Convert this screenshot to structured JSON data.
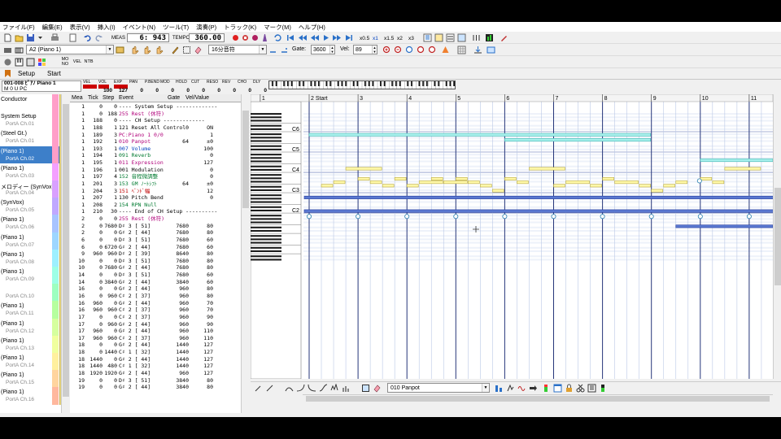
{
  "menu": [
    "ファイル(F)",
    "編集(E)",
    "表示(V)",
    "挿入(I)",
    "イベント(N)",
    "ツール(T)",
    "演奏(P)",
    "トラック(K)",
    "マーク(M)",
    "ヘルプ(H)"
  ],
  "transport": {
    "meas_label": "MEAS",
    "position": "6: 943",
    "tempo_label": "TEMPO",
    "tempo": "360.00",
    "speed_buttons": [
      "x0.5",
      "x1",
      "x1.5",
      "x2",
      "x3"
    ]
  },
  "toolbar2": {
    "track_select": "A2 (Piano 1)",
    "quantize": "16分音符",
    "gate_label": "Gate:",
    "gate": "3600",
    "vel_label": "Vel:",
    "vel": "89"
  },
  "toolbar3": {
    "toggles": [
      "MO\nNO",
      "VEL",
      "NTB"
    ]
  },
  "tabs": {
    "setup": "Setup",
    "start": "Start"
  },
  "strip": {
    "track_line1": "001-008 ﾋﾟｱﾉ Piano 1",
    "track_line2": "M   0   U   PC",
    "params": [
      {
        "name": "VEL",
        "value": "",
        "level": 1.0
      },
      {
        "name": "VOL",
        "value": "100",
        "level": 0.79
      },
      {
        "name": "EXP",
        "value": "127",
        "level": 1.0
      },
      {
        "name": "PAN",
        "value": "0",
        "level": 0.0
      },
      {
        "name": "P.BEND",
        "value": "0",
        "level": 0.0
      },
      {
        "name": "MOD",
        "value": "0",
        "level": 0.0
      },
      {
        "name": "HOLD",
        "value": "0",
        "level": 0.0
      },
      {
        "name": "CUT",
        "value": "0",
        "level": 0.0
      },
      {
        "name": "RESO",
        "value": "0",
        "level": 0.0
      },
      {
        "name": "REV",
        "value": "0",
        "level": 0.0
      },
      {
        "name": "CHO",
        "value": "0",
        "level": 0.0
      },
      {
        "name": "DLY",
        "value": "0",
        "level": 0.0
      }
    ]
  },
  "tracks": [
    {
      "name": "Conductor",
      "port": "",
      "color": "#ff9ec8"
    },
    {
      "name": "System Setup",
      "port": "PortA  Ch.01",
      "color": "#ff9ec8"
    },
    {
      "name": "(Steel Gt.)",
      "port": "PortA  Ch.01",
      "color": "#ff9ec8"
    },
    {
      "name": "(Piano 1)",
      "port": "PortA  Ch.02",
      "color": "#ff9ec8",
      "selected": true
    },
    {
      "name": "(Piano 1)",
      "port": "PortA  Ch.03",
      "color": "#f4a0ff"
    },
    {
      "name": "メロディー (SynVox)",
      "port": "PortA  Ch.04",
      "color": "#d9a0ff"
    },
    {
      "name": "(SynVox)",
      "port": "PortA  Ch.05",
      "color": "#c0a8ff"
    },
    {
      "name": "(Piano 1)",
      "port": "PortA  Ch.06",
      "color": "#a8c4ff"
    },
    {
      "name": "(Piano 1)",
      "port": "PortA  Ch.07",
      "color": "#9ed6ff"
    },
    {
      "name": "(Piano 1)",
      "port": "PortA  Ch.08",
      "color": "#9ef0ff"
    },
    {
      "name": "(Piano 1)",
      "port": "PortA  Ch.09",
      "color": "#9effe6"
    },
    {
      "name": "",
      "port": "PortA  Ch.10",
      "color": "#9effc0"
    },
    {
      "name": "(Piano 1)",
      "port": "PortA  Ch.11",
      "color": "#b6ff9e"
    },
    {
      "name": "(Piano 1)",
      "port": "PortA  Ch.12",
      "color": "#d6ff9e"
    },
    {
      "name": "(Piano 1)",
      "port": "PortA  Ch.13",
      "color": "#f0ff9e"
    },
    {
      "name": "(Piano 1)",
      "port": "PortA  Ch.14",
      "color": "#fff09e"
    },
    {
      "name": "(Piano 1)",
      "port": "PortA  Ch.15",
      "color": "#ffd49e"
    },
    {
      "name": "(Piano 1)",
      "port": "PortA  Ch.16",
      "color": "#ffb89e"
    }
  ],
  "event_headers": [
    "Mea",
    "Tick",
    "Step",
    "Event",
    "Gate",
    "Vel/Value"
  ],
  "events": [
    [
      "1",
      "0",
      "0",
      "---- System Setup -------------",
      "",
      "",
      "#000"
    ],
    [
      "1",
      "0",
      "188",
      "255 Rest (休符)",
      "",
      "",
      "#b0007a"
    ],
    [
      "1",
      "188",
      "0",
      "---- CH Setup -------------",
      "",
      "",
      "#000"
    ],
    [
      "1",
      "188",
      "1",
      "121 Reset All Control",
      "0",
      "ON",
      "#000"
    ],
    [
      "1",
      "189",
      "3",
      "PC:Piano 1        0/0",
      "",
      "1",
      "#b0007a"
    ],
    [
      "1",
      "192",
      "1",
      "010 Panpot",
      "64",
      "±0",
      "#b0007a"
    ],
    [
      "1",
      "193",
      "1",
      "007 Volume",
      "",
      "100",
      "#0040c0"
    ],
    [
      "1",
      "194",
      "1",
      "091 Reverb",
      "",
      "0",
      "#007a30"
    ],
    [
      "1",
      "195",
      "1",
      "011 Expression",
      "",
      "127",
      "#b0007a"
    ],
    [
      "1",
      "196",
      "1",
      "001 Modulation",
      "",
      "0",
      "#000"
    ],
    [
      "1",
      "197",
      "4",
      "152 音程微調整",
      "",
      "0",
      "#007a30"
    ],
    [
      "1",
      "201",
      "3",
      "153 GM ﾉｰﾄｼﾌﾄ",
      "64",
      "±0",
      "#007a30"
    ],
    [
      "1",
      "204",
      "3",
      "151 ﾍﾞﾝﾄﾞ幅",
      "",
      "12",
      "#c00000"
    ],
    [
      "1",
      "207",
      "1",
      "130 Pitch Bend",
      "",
      "0",
      "#000"
    ],
    [
      "1",
      "208",
      "2",
      "154 RPN Null",
      "",
      "",
      "#007a30"
    ],
    [
      "1",
      "210",
      "30",
      "---- End of CH Setup ----------",
      "",
      "",
      "#000"
    ],
    [
      "2",
      "0",
      "0",
      "255 Rest (休符)",
      "",
      "",
      "#b0007a"
    ],
    [
      "2",
      "0",
      "7680",
      "D♯ 3 [ 51]",
      "7680",
      "80",
      "#000"
    ],
    [
      "2",
      "0",
      "0",
      "G♯ 2 [ 44]",
      "7680",
      "80",
      "#000"
    ],
    [
      "6",
      "0",
      "0",
      "D♯ 3 [ 51]",
      "7680",
      "60",
      "#000"
    ],
    [
      "6",
      "0",
      "6720",
      "G♯ 2 [ 44]",
      "7680",
      "60",
      "#000"
    ],
    [
      "9",
      "960",
      "960",
      "D♯ 2 [ 39]",
      "8640",
      "80",
      "#000"
    ],
    [
      "10",
      "0",
      "0",
      "D♯ 3 [ 51]",
      "7680",
      "80",
      "#000"
    ],
    [
      "10",
      "0",
      "7680",
      "G♯ 2 [ 44]",
      "7680",
      "80",
      "#000"
    ],
    [
      "14",
      "0",
      "0",
      "D♯ 3 [ 51]",
      "7680",
      "60",
      "#000"
    ],
    [
      "14",
      "0",
      "3840",
      "G♯ 2 [ 44]",
      "3840",
      "60",
      "#000"
    ],
    [
      "16",
      "0",
      "0",
      "G♯ 2 [ 44]",
      "960",
      "80",
      "#000"
    ],
    [
      "16",
      "0",
      "960",
      "C♯ 2 [ 37]",
      "960",
      "80",
      "#000"
    ],
    [
      "16",
      "960",
      "0",
      "G♯ 2 [ 44]",
      "960",
      "70",
      "#000"
    ],
    [
      "16",
      "960",
      "960",
      "C♯ 2 [ 37]",
      "960",
      "70",
      "#000"
    ],
    [
      "17",
      "0",
      "0",
      "C♯ 2 [ 37]",
      "960",
      "90",
      "#000"
    ],
    [
      "17",
      "0",
      "960",
      "G♯ 2 [ 44]",
      "960",
      "90",
      "#000"
    ],
    [
      "17",
      "960",
      "0",
      "G♯ 2 [ 44]",
      "960",
      "110",
      "#000"
    ],
    [
      "17",
      "960",
      "960",
      "C♯ 2 [ 37]",
      "960",
      "110",
      "#000"
    ],
    [
      "18",
      "0",
      "0",
      "G♯ 2 [ 44]",
      "1440",
      "127",
      "#000"
    ],
    [
      "18",
      "0",
      "1440",
      "C♯ 1 [ 32]",
      "1440",
      "127",
      "#000"
    ],
    [
      "18",
      "1440",
      "0",
      "G♯ 2 [ 44]",
      "1440",
      "127",
      "#000"
    ],
    [
      "18",
      "1440",
      "480",
      "C♯ 1 [ 32]",
      "1440",
      "127",
      "#000"
    ],
    [
      "18",
      "1920",
      "1920",
      "G♯ 2 [ 44]",
      "960",
      "127",
      "#000"
    ],
    [
      "19",
      "0",
      "0",
      "D♯ 3 [ 51]",
      "3840",
      "80",
      "#000"
    ],
    [
      "19",
      "0",
      "0",
      "G♯ 2 [ 44]",
      "3840",
      "80",
      "#000"
    ]
  ],
  "roll": {
    "measures": [
      "1",
      "2 Start",
      "3",
      "4",
      "5",
      "6",
      "7",
      "8",
      "9",
      "10",
      "11"
    ],
    "octaves": [
      "C6",
      "C5",
      "C4",
      "C3",
      "C2"
    ],
    "colors": {
      "cyan": "#a8f0ec",
      "cyan_border": "#46b8b4",
      "yellow": "#fff8a8",
      "yellow_border": "#b8a840",
      "blue": "#5a78d0",
      "blue_border": "#2a40a0",
      "grid_beat": "#bac8e6",
      "grid_bar": "#26367a"
    }
  },
  "bottom_toolbar": {
    "event_select": "010 Panpot"
  }
}
